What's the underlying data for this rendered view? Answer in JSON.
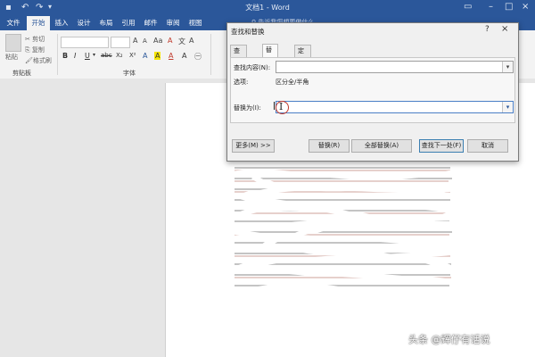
{
  "window": {
    "title": "文档1 - Word",
    "quick_access": [
      "save-icon",
      "undo-icon",
      "redo-icon"
    ],
    "controls": [
      "ribbon-options-icon",
      "minimize-icon",
      "maximize-icon",
      "close-icon"
    ]
  },
  "ribbon": {
    "tabs": [
      {
        "label": "文件",
        "active": false
      },
      {
        "label": "开始",
        "active": true
      },
      {
        "label": "插入",
        "active": false
      },
      {
        "label": "设计",
        "active": false
      },
      {
        "label": "布局",
        "active": false
      },
      {
        "label": "引用",
        "active": false
      },
      {
        "label": "邮件",
        "active": false
      },
      {
        "label": "审阅",
        "active": false
      },
      {
        "label": "视图",
        "active": false
      }
    ],
    "tell_me": "♀ 告诉我您想要做什么",
    "clipboard": {
      "paste": "粘贴",
      "cut": "剪切",
      "copy": "复制",
      "format_painter": "格式刷",
      "group_label": "剪贴板"
    },
    "font": {
      "group_label": "字体",
      "grow": "A",
      "shrink": "A",
      "bold": "B",
      "italic": "I",
      "underline": "U",
      "strike": "abc",
      "sub": "X₂",
      "sup": "X²",
      "clear": "A",
      "highlight": "A",
      "color": "A",
      "aa": "Aa"
    },
    "accent": "#2b579a"
  },
  "dialog": {
    "title": "查找和替换",
    "help": "?",
    "close": "×",
    "tabs": [
      {
        "label": "查找(D)",
        "active": false
      },
      {
        "label": "替换(P)",
        "active": true
      },
      {
        "label": "定位(G)",
        "active": false
      }
    ],
    "find_label": "查找内容(N):",
    "find_value": "",
    "options_label": "选项:",
    "options_value": "区分全/半角",
    "replace_label": "替换为(I):",
    "replace_value": "",
    "buttons": {
      "more": "更多(M) >>",
      "replace": "替换(R)",
      "replace_all": "全部替换(A)",
      "find_next": "查找下一处(F)",
      "cancel": "取消"
    }
  },
  "watermark": "头条 @辉仔有话说"
}
